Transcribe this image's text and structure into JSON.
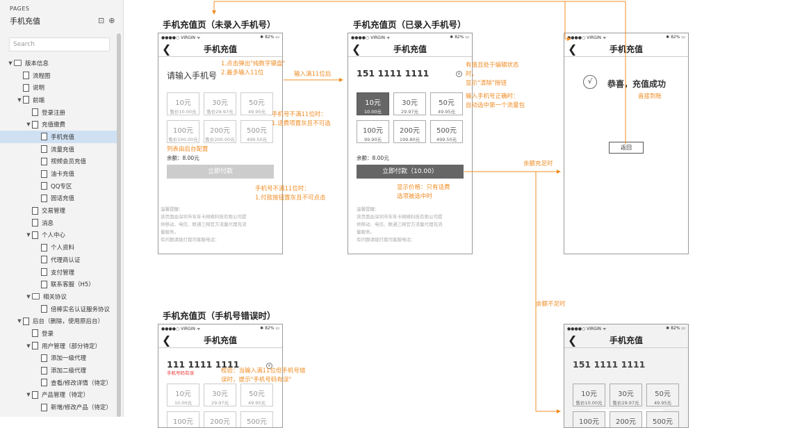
{
  "sidebar": {
    "section_label": "PAGES",
    "title": "手机充值",
    "search_placeholder": "Search",
    "tree": [
      {
        "d": 0,
        "t": "▼",
        "k": "fold",
        "label": "版本信息"
      },
      {
        "d": 1,
        "t": "",
        "k": "page",
        "label": "流程图"
      },
      {
        "d": 1,
        "t": "",
        "k": "page",
        "label": "说明"
      },
      {
        "d": 1,
        "t": "▼",
        "k": "page",
        "label": "前端"
      },
      {
        "d": 2,
        "t": "",
        "k": "page",
        "label": "登录注册"
      },
      {
        "d": 2,
        "t": "▼",
        "k": "page",
        "label": "充值缴费"
      },
      {
        "d": 3,
        "t": "",
        "k": "page",
        "label": "手机充值",
        "selected": true
      },
      {
        "d": 3,
        "t": "",
        "k": "page",
        "label": "流量充值"
      },
      {
        "d": 3,
        "t": "",
        "k": "page",
        "label": "视频会员充值"
      },
      {
        "d": 3,
        "t": "",
        "k": "page",
        "label": "油卡充值"
      },
      {
        "d": 3,
        "t": "",
        "k": "page",
        "label": "QQ专区"
      },
      {
        "d": 3,
        "t": "",
        "k": "page",
        "label": "固话充值"
      },
      {
        "d": 2,
        "t": "",
        "k": "page",
        "label": "交易管理"
      },
      {
        "d": 2,
        "t": "",
        "k": "page",
        "label": "消息"
      },
      {
        "d": 2,
        "t": "▼",
        "k": "page",
        "label": "个人中心"
      },
      {
        "d": 3,
        "t": "",
        "k": "page",
        "label": "个人资料"
      },
      {
        "d": 3,
        "t": "",
        "k": "page",
        "label": "代理商认证"
      },
      {
        "d": 3,
        "t": "",
        "k": "page",
        "label": "支付管理"
      },
      {
        "d": 3,
        "t": "",
        "k": "page",
        "label": "联系客服（H5）"
      },
      {
        "d": 2,
        "t": "▼",
        "k": "fold",
        "label": "相关协议"
      },
      {
        "d": 3,
        "t": "",
        "k": "page",
        "label": "倍棒实名认证服务协议"
      },
      {
        "d": 1,
        "t": "▼",
        "k": "page",
        "label": "后台（删除，使用原后台）"
      },
      {
        "d": 2,
        "t": "",
        "k": "page",
        "label": "登录"
      },
      {
        "d": 2,
        "t": "▼",
        "k": "page",
        "label": "用户管理（部分待定）"
      },
      {
        "d": 3,
        "t": "",
        "k": "page",
        "label": "添加一级代理"
      },
      {
        "d": 3,
        "t": "",
        "k": "page",
        "label": "添加二级代理"
      },
      {
        "d": 3,
        "t": "",
        "k": "page",
        "label": "查看/修改详情（待定）"
      },
      {
        "d": 2,
        "t": "▼",
        "k": "page",
        "label": "产品管理（待定）"
      },
      {
        "d": 3,
        "t": "",
        "k": "page",
        "label": "新增/修改产品（待定）"
      }
    ]
  },
  "status": {
    "carrier": "●●●●○ VIRGIN ᯤ",
    "right": "✱ 82% ▭"
  },
  "nav_title": "手机充值",
  "frames": {
    "f1": {
      "label": "手机充值页（未录入手机号）",
      "phone_placeholder": "请输入手机号",
      "balance": "余额：8.00元",
      "pay": "立即付款",
      "tips": [
        "温馨提醒：",
        "该页面由深圳市年年卡网络科技有限公司提",
        "供移动、电信、联通三网官方流量代理充流",
        "量服务。",
        "有问题请拨打我司客服电话："
      ]
    },
    "f2": {
      "label": "手机充值页（已录入手机号）",
      "phone": "151 1111 1111",
      "balance": "余额：8.00元",
      "pay": "立即付款（10.00）",
      "tips": [
        "温馨提醒：",
        "该页面由深圳市年年卡网络科技有限公司提",
        "供移动、电信、联通三网官方流量代理充流",
        "量服务。",
        "有问题请拨打我司客服电话："
      ]
    },
    "f3": {
      "success": "恭喜，充值成功",
      "check": "√",
      "back": "返回"
    },
    "f4": {
      "label": "手机充值页（手机号错误时）",
      "phone": "111 1111 1111",
      "error": "手机号码有误"
    },
    "f5": {
      "phone": "151 1111 1111"
    }
  },
  "tiles": [
    {
      "a": "10元",
      "b": "10.00元",
      "p": "售价10.00元"
    },
    {
      "a": "30元",
      "b": "29.97元",
      "p": "售价29.97元"
    },
    {
      "a": "50元",
      "b": "49.95元",
      "p": "49.95元"
    },
    {
      "a": "100元",
      "b": "99.90元",
      "p": "售价100.00元"
    },
    {
      "a": "200元",
      "b": "199.80元",
      "p": "售价200.00元"
    },
    {
      "a": "500元",
      "b": "499.50元",
      "p": "499.50元"
    }
  ],
  "notes": {
    "n1": "1.点击弹出\"纯数字键盘\"\n2.最多输入11位",
    "n2": "输入满11位后",
    "n3": "手机号不满11位时：\n1.话费项置灰且不可选",
    "n4": "列表由后台配置",
    "n5": "手机号不满11位时：\n1.付款按钮置灰且不可点击",
    "n6": "有值且处于编辑状态\n时，\n显示\"清除\"按钮",
    "n7": "输入手机号正确时：\n自动选中第一个流量包",
    "n8": "显示价格：只有话费\n选项被选中时",
    "n9": "余额充足时",
    "n10": "直接到账",
    "n11": "余额不足时",
    "n12": "校验：当输入满11位但手机号错\n误时，提示\"手机号码有误\""
  },
  "colors": {
    "orange": "#f08c24",
    "selected_tile": "#666666"
  }
}
